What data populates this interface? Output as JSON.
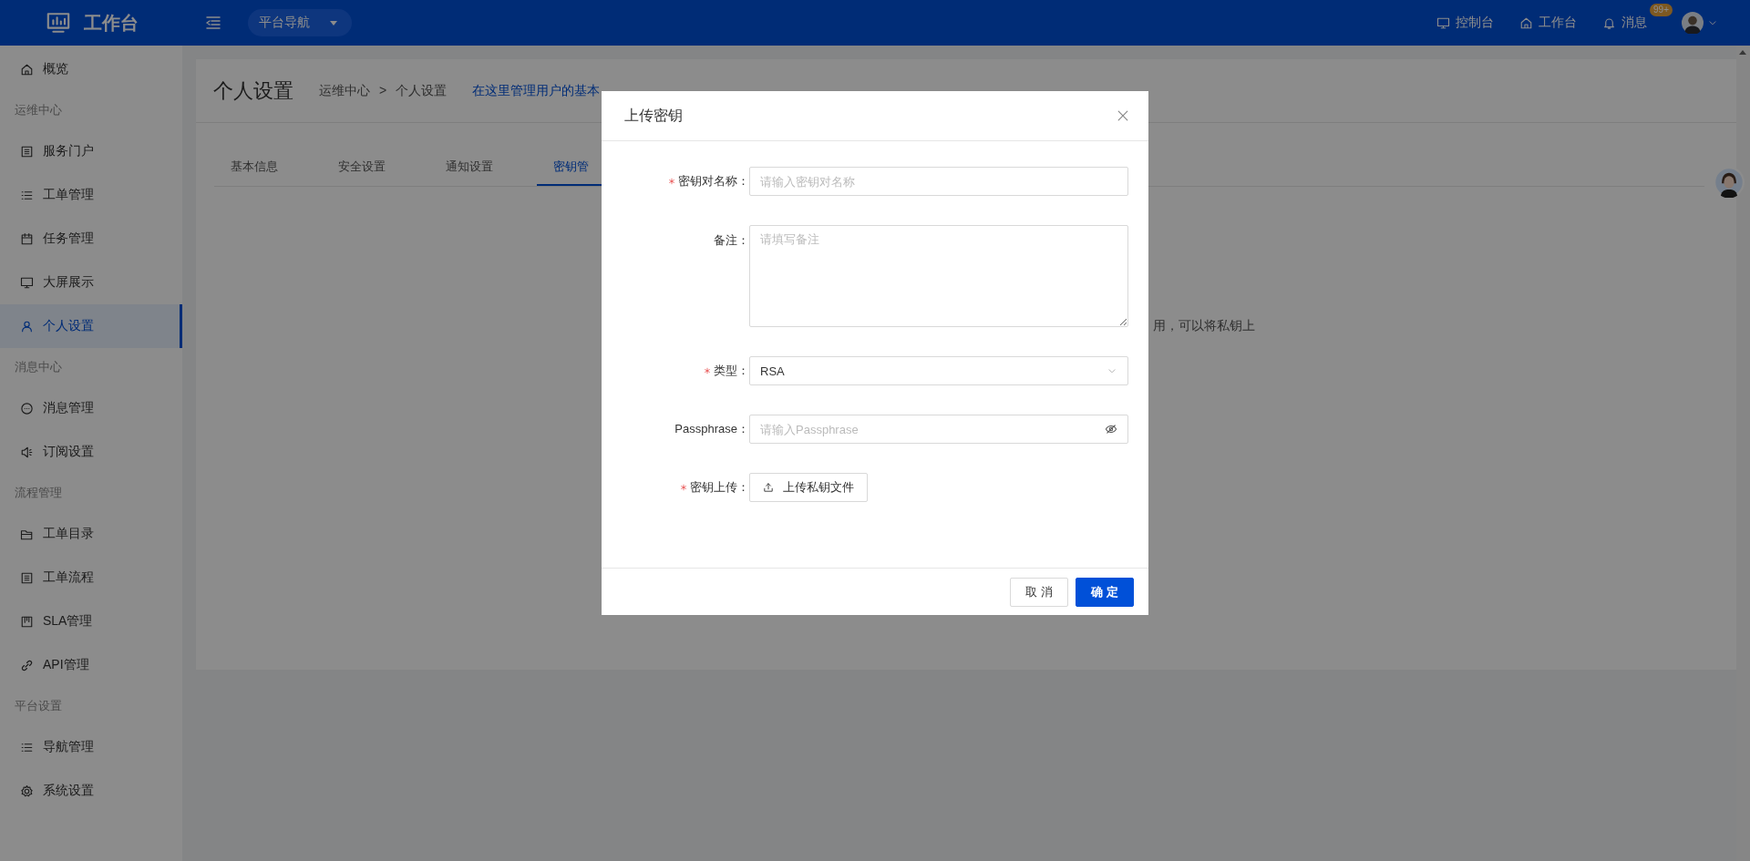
{
  "topbar": {
    "logo": "工作台",
    "platform_nav": "平台导航",
    "actions": [
      {
        "kind": "monitor",
        "label": "控制台"
      },
      {
        "kind": "home",
        "label": "工作台"
      },
      {
        "kind": "bell",
        "label": "消息",
        "badge": "99+"
      }
    ]
  },
  "sidebar": {
    "items": [
      {
        "kind": "item",
        "label": "概览",
        "selected": false
      },
      {
        "kind": "group",
        "label": "运维中心"
      },
      {
        "kind": "item",
        "label": "服务门户",
        "selected": false
      },
      {
        "kind": "item",
        "label": "工单管理",
        "selected": false
      },
      {
        "kind": "item",
        "label": "任务管理",
        "selected": false
      },
      {
        "kind": "item",
        "label": "大屏展示",
        "selected": false
      },
      {
        "kind": "item",
        "label": "个人设置",
        "selected": true
      },
      {
        "kind": "group",
        "label": "消息中心"
      },
      {
        "kind": "item",
        "label": "消息管理",
        "selected": false
      },
      {
        "kind": "item",
        "label": "订阅设置",
        "selected": false
      },
      {
        "kind": "group",
        "label": "流程管理"
      },
      {
        "kind": "item",
        "label": "工单目录",
        "selected": false
      },
      {
        "kind": "item",
        "label": "工单流程",
        "selected": false
      },
      {
        "kind": "item",
        "label": "SLA管理",
        "selected": false
      },
      {
        "kind": "item",
        "label": "API管理",
        "selected": false
      },
      {
        "kind": "group",
        "label": "平台设置"
      },
      {
        "kind": "item",
        "label": "导航管理",
        "selected": false
      },
      {
        "kind": "item",
        "label": "系统设置",
        "selected": false
      }
    ]
  },
  "page": {
    "title": "个人设置",
    "breadcrumb": [
      "运维中心",
      "个人设置"
    ],
    "separator": ">",
    "description": "在这里管理用户的基本",
    "tabs": [
      {
        "label": "基本信息",
        "selected": false
      },
      {
        "label": "安全设置",
        "selected": false
      },
      {
        "label": "通知设置",
        "selected": false
      },
      {
        "label": "密钥管",
        "selected": true
      }
    ],
    "body_text": "用，可以将私钥上"
  },
  "modal": {
    "title": "上传密钥",
    "fields": [
      {
        "kind": "input",
        "label": "密钥对名称：",
        "required": true,
        "placeholder": "请输入密钥对名称"
      },
      {
        "kind": "textarea",
        "label": "备注：",
        "required": false,
        "placeholder": "请填写备注"
      },
      {
        "kind": "select",
        "label": "类型：",
        "required": true,
        "value": "RSA"
      },
      {
        "kind": "password",
        "label": "Passphrase：",
        "required": false,
        "placeholder": "请输入Passphrase"
      },
      {
        "kind": "upload",
        "label": "密钥上传：",
        "required": true,
        "button": "上传私钥文件"
      }
    ],
    "buttons": [
      {
        "kind": "secondary",
        "label": "取 消"
      },
      {
        "kind": "primary",
        "label": "确 定"
      }
    ]
  }
}
